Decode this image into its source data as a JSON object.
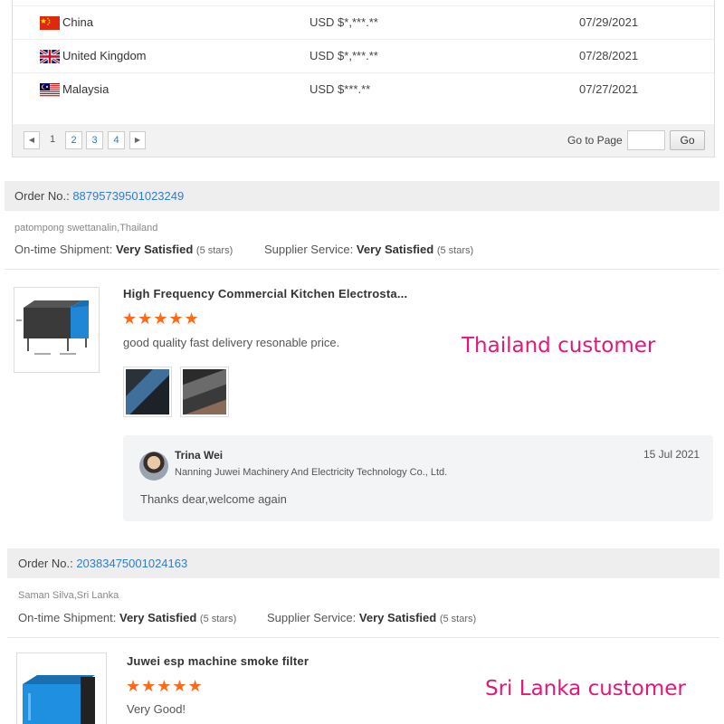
{
  "transactions": [
    {
      "country": "China",
      "flag": "china-flag-icon",
      "amount": "USD $*,***.**",
      "date": "07/29/2021"
    },
    {
      "country": "United Kingdom",
      "flag": "uk-flag-icon",
      "amount": "USD $*,***.**",
      "date": "07/28/2021"
    },
    {
      "country": "Malaysia",
      "flag": "malaysia-flag-icon",
      "amount": "USD $***.**",
      "date": "07/27/2021"
    }
  ],
  "pagination": {
    "pages": [
      "1",
      "2",
      "3",
      "4"
    ],
    "current": "1",
    "goto_label": "Go to Page",
    "goto_value": "",
    "go_button": "Go"
  },
  "reviews": [
    {
      "order_label": "Order No.:",
      "order_number": "88795739501023249",
      "buyer": "patompong swettanalin,Thailand",
      "shipment_label": "On-time Shipment:",
      "shipment_value": "Very Satisfied",
      "shipment_stars": "(5 stars)",
      "service_label": "Supplier Service:",
      "service_value": "Very Satisfied",
      "service_stars": "(5 stars)",
      "product_title": "High Frequency Commercial Kitchen Electrosta...",
      "rating": 5,
      "comment": "good quality fast delivery resonable price.",
      "reply": {
        "name": "Trina Wei",
        "company": "Nanning Juwei Machinery And Electricity Technology Co., Ltd.",
        "date": "15 Jul 2021",
        "text": "Thanks dear,welcome again"
      },
      "annotation": "Thailand customer"
    },
    {
      "order_label": "Order No.:",
      "order_number": "20383475001024163",
      "buyer": "Saman Silva,Sri Lanka",
      "shipment_label": "On-time Shipment:",
      "shipment_value": "Very Satisfied",
      "shipment_stars": "(5 stars)",
      "service_label": "Supplier Service:",
      "service_value": "Very Satisfied",
      "service_stars": "(5 stars)",
      "product_title": "Juwei esp machine smoke filter",
      "rating": 5,
      "comment": "Very Good!",
      "annotation": "Sri Lanka customer"
    }
  ],
  "colors": {
    "link": "#2f7dd0",
    "stars": "#ff6a1a",
    "annotation": "#e0187a"
  }
}
